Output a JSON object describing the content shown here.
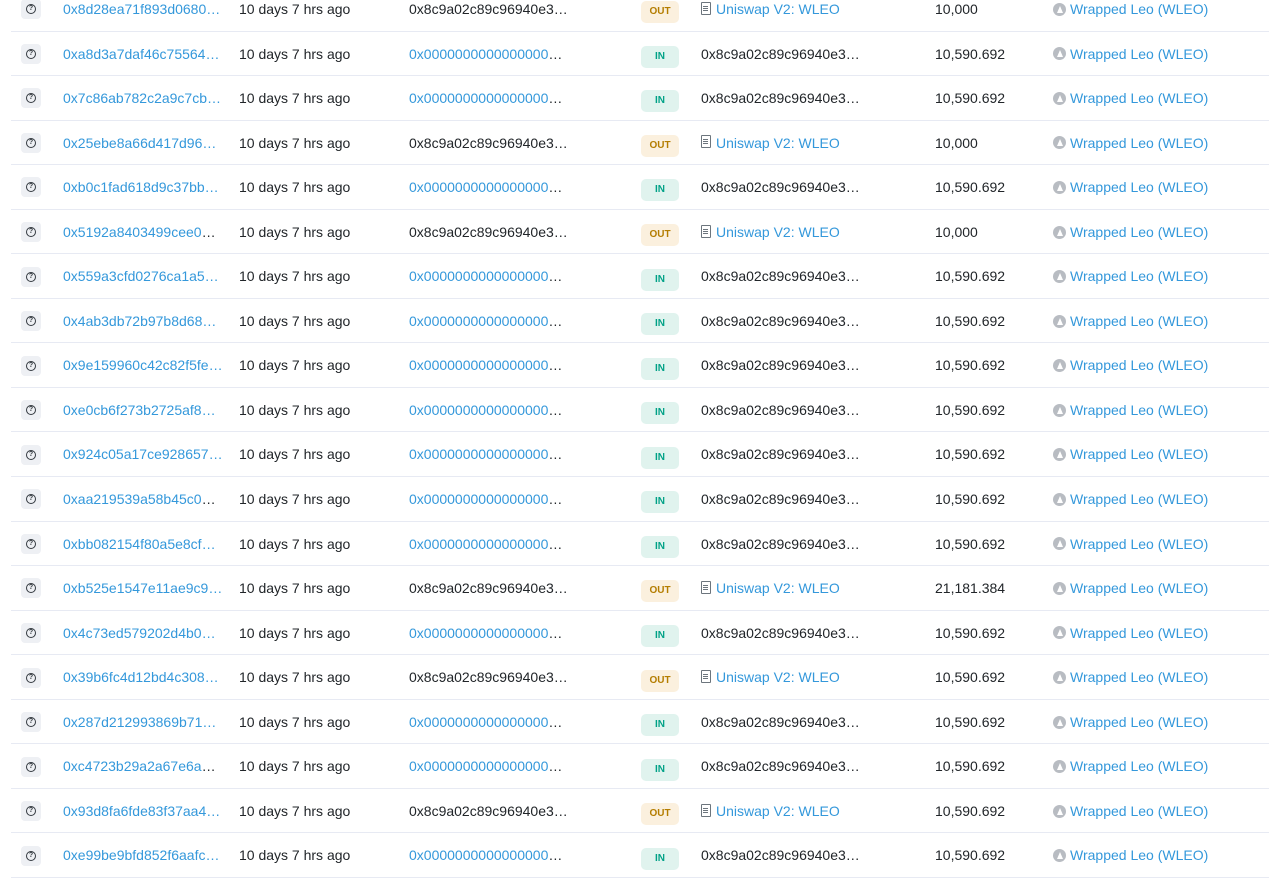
{
  "rows": [
    {
      "hash": "0x8d28ea71f893d0680…",
      "age": "10 days 7 hrs ago",
      "from": "0x8c9a02c89c96940e3…",
      "from_link": false,
      "dir": "OUT",
      "to": "Uniswap V2: WLEO",
      "to_contract": true,
      "qty": "10,000",
      "token": "Wrapped Leo (WLEO)"
    },
    {
      "hash": "0xa8d3a7daf46c75564…",
      "age": "10 days 7 hrs ago",
      "from": "0x00000000000000000…",
      "from_link": true,
      "dir": "IN",
      "to": "0x8c9a02c89c96940e3…",
      "to_contract": false,
      "qty": "10,590.692",
      "token": "Wrapped Leo (WLEO)"
    },
    {
      "hash": "0x7c86ab782c2a9c7cb…",
      "age": "10 days 7 hrs ago",
      "from": "0x00000000000000000…",
      "from_link": true,
      "dir": "IN",
      "to": "0x8c9a02c89c96940e3…",
      "to_contract": false,
      "qty": "10,590.692",
      "token": "Wrapped Leo (WLEO)"
    },
    {
      "hash": "0x25ebe8a66d417d96…",
      "age": "10 days 7 hrs ago",
      "from": "0x8c9a02c89c96940e3…",
      "from_link": false,
      "dir": "OUT",
      "to": "Uniswap V2: WLEO",
      "to_contract": true,
      "qty": "10,000",
      "token": "Wrapped Leo (WLEO)"
    },
    {
      "hash": "0xb0c1fad618d9c37bb…",
      "age": "10 days 7 hrs ago",
      "from": "0x00000000000000000…",
      "from_link": true,
      "dir": "IN",
      "to": "0x8c9a02c89c96940e3…",
      "to_contract": false,
      "qty": "10,590.692",
      "token": "Wrapped Leo (WLEO)"
    },
    {
      "hash": "0x5192a8403499cee09…",
      "age": "10 days 7 hrs ago",
      "from": "0x8c9a02c89c96940e3…",
      "from_link": false,
      "dir": "OUT",
      "to": "Uniswap V2: WLEO",
      "to_contract": true,
      "qty": "10,000",
      "token": "Wrapped Leo (WLEO)"
    },
    {
      "hash": "0x559a3cfd0276ca1a5…",
      "age": "10 days 7 hrs ago",
      "from": "0x00000000000000000…",
      "from_link": true,
      "dir": "IN",
      "to": "0x8c9a02c89c96940e3…",
      "to_contract": false,
      "qty": "10,590.692",
      "token": "Wrapped Leo (WLEO)"
    },
    {
      "hash": "0x4ab3db72b97b8d68…",
      "age": "10 days 7 hrs ago",
      "from": "0x00000000000000000…",
      "from_link": true,
      "dir": "IN",
      "to": "0x8c9a02c89c96940e3…",
      "to_contract": false,
      "qty": "10,590.692",
      "token": "Wrapped Leo (WLEO)"
    },
    {
      "hash": "0x9e159960c42c82f5fe…",
      "age": "10 days 7 hrs ago",
      "from": "0x00000000000000000…",
      "from_link": true,
      "dir": "IN",
      "to": "0x8c9a02c89c96940e3…",
      "to_contract": false,
      "qty": "10,590.692",
      "token": "Wrapped Leo (WLEO)"
    },
    {
      "hash": "0xe0cb6f273b2725af8…",
      "age": "10 days 7 hrs ago",
      "from": "0x00000000000000000…",
      "from_link": true,
      "dir": "IN",
      "to": "0x8c9a02c89c96940e3…",
      "to_contract": false,
      "qty": "10,590.692",
      "token": "Wrapped Leo (WLEO)"
    },
    {
      "hash": "0x924c05a17ce928657…",
      "age": "10 days 7 hrs ago",
      "from": "0x00000000000000000…",
      "from_link": true,
      "dir": "IN",
      "to": "0x8c9a02c89c96940e3…",
      "to_contract": false,
      "qty": "10,590.692",
      "token": "Wrapped Leo (WLEO)"
    },
    {
      "hash": "0xaa219539a58b45c08…",
      "age": "10 days 7 hrs ago",
      "from": "0x00000000000000000…",
      "from_link": true,
      "dir": "IN",
      "to": "0x8c9a02c89c96940e3…",
      "to_contract": false,
      "qty": "10,590.692",
      "token": "Wrapped Leo (WLEO)"
    },
    {
      "hash": "0xbb082154f80a5e8cf…",
      "age": "10 days 7 hrs ago",
      "from": "0x00000000000000000…",
      "from_link": true,
      "dir": "IN",
      "to": "0x8c9a02c89c96940e3…",
      "to_contract": false,
      "qty": "10,590.692",
      "token": "Wrapped Leo (WLEO)"
    },
    {
      "hash": "0xb525e1547e11ae9c9…",
      "age": "10 days 7 hrs ago",
      "from": "0x8c9a02c89c96940e3…",
      "from_link": false,
      "dir": "OUT",
      "to": "Uniswap V2: WLEO",
      "to_contract": true,
      "qty": "21,181.384",
      "token": "Wrapped Leo (WLEO)"
    },
    {
      "hash": "0x4c73ed579202d4b0…",
      "age": "10 days 7 hrs ago",
      "from": "0x00000000000000000…",
      "from_link": true,
      "dir": "IN",
      "to": "0x8c9a02c89c96940e3…",
      "to_contract": false,
      "qty": "10,590.692",
      "token": "Wrapped Leo (WLEO)"
    },
    {
      "hash": "0x39b6fc4d12bd4c308…",
      "age": "10 days 7 hrs ago",
      "from": "0x8c9a02c89c96940e3…",
      "from_link": false,
      "dir": "OUT",
      "to": "Uniswap V2: WLEO",
      "to_contract": true,
      "qty": "10,590.692",
      "token": "Wrapped Leo (WLEO)"
    },
    {
      "hash": "0x287d212993869b71…",
      "age": "10 days 7 hrs ago",
      "from": "0x00000000000000000…",
      "from_link": true,
      "dir": "IN",
      "to": "0x8c9a02c89c96940e3…",
      "to_contract": false,
      "qty": "10,590.692",
      "token": "Wrapped Leo (WLEO)"
    },
    {
      "hash": "0xc4723b29a2a67e6a8…",
      "age": "10 days 7 hrs ago",
      "from": "0x00000000000000000…",
      "from_link": true,
      "dir": "IN",
      "to": "0x8c9a02c89c96940e3…",
      "to_contract": false,
      "qty": "10,590.692",
      "token": "Wrapped Leo (WLEO)"
    },
    {
      "hash": "0x93d8fa6fde83f37aa4…",
      "age": "10 days 7 hrs ago",
      "from": "0x8c9a02c89c96940e3…",
      "from_link": false,
      "dir": "OUT",
      "to": "Uniswap V2: WLEO",
      "to_contract": true,
      "qty": "10,590.692",
      "token": "Wrapped Leo (WLEO)"
    },
    {
      "hash": "0xe99be9bfd852f6aafc…",
      "age": "10 days 7 hrs ago",
      "from": "0x00000000000000000…",
      "from_link": true,
      "dir": "IN",
      "to": "0x8c9a02c89c96940e3…",
      "to_contract": false,
      "qty": "10,590.692",
      "token": "Wrapped Leo (WLEO)"
    }
  ],
  "icons": {
    "view": "eye-icon",
    "contract": "file-contract-icon",
    "token": "token-icon"
  },
  "colors": {
    "link": "#3498db",
    "in_badge_bg": "#e0f3ee",
    "in_badge_text": "#00a186",
    "out_badge_bg": "#fbf0de",
    "out_badge_text": "#b47d00",
    "row_border": "#e7eaf3"
  }
}
